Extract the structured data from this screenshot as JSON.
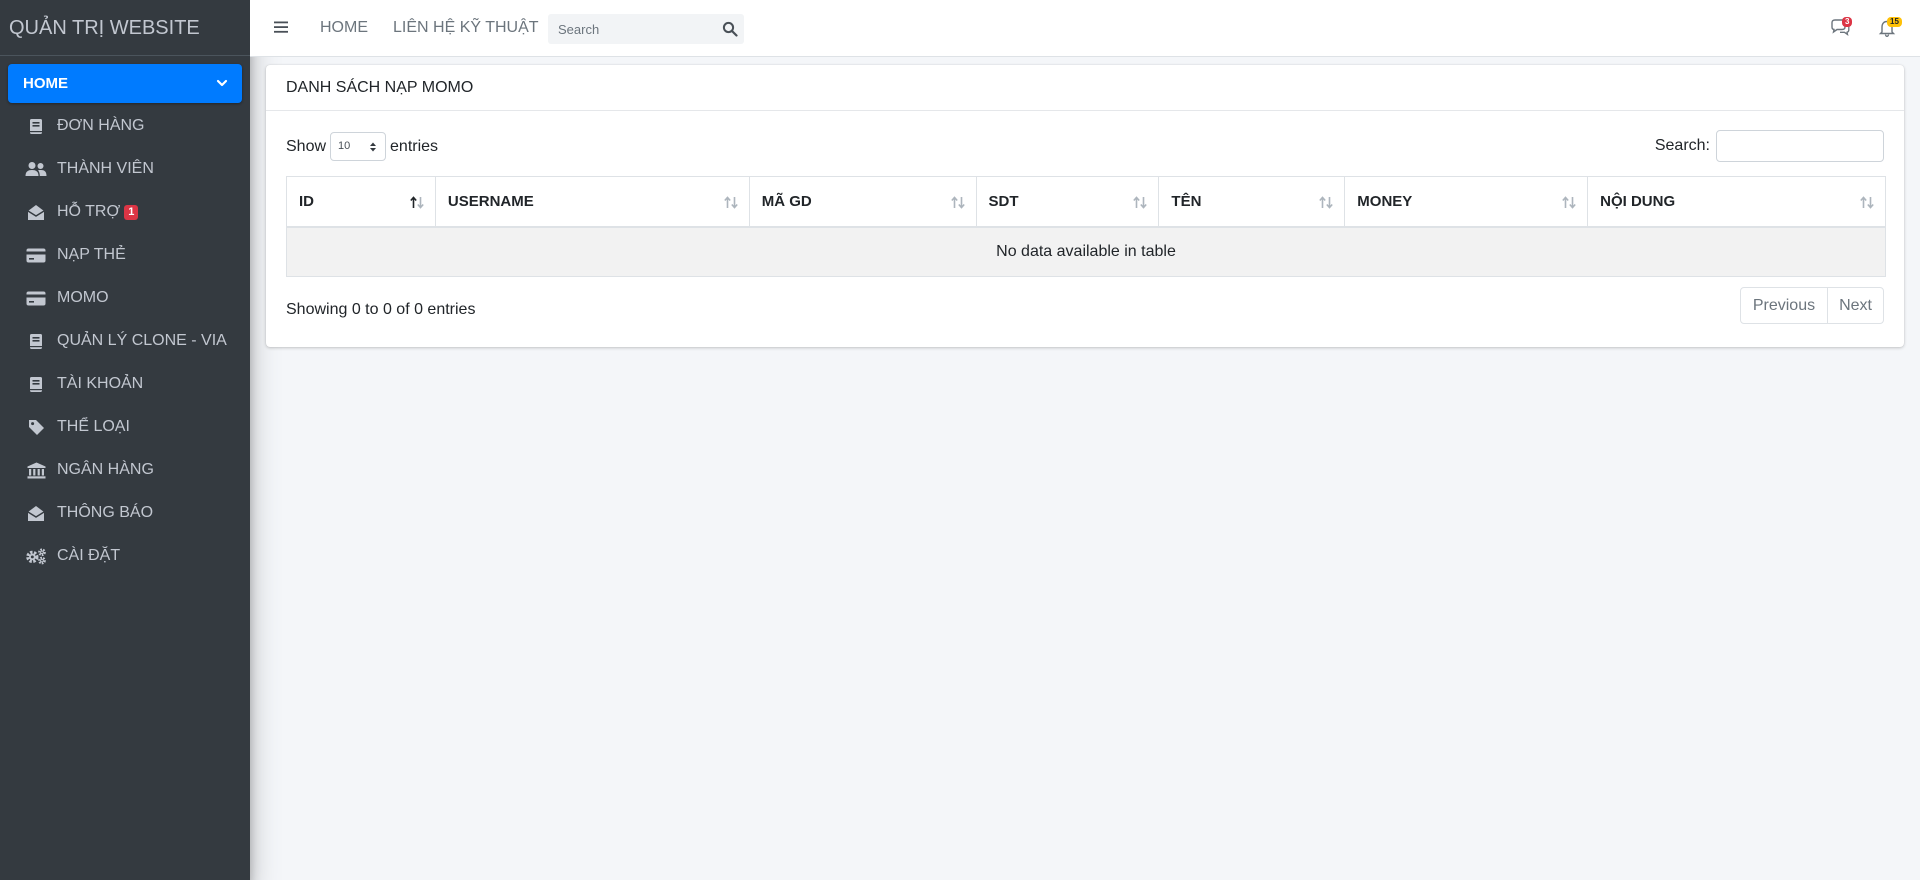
{
  "brand": "QUẢN TRỊ WEBSITE",
  "sidebar": {
    "active": "HOME",
    "items": [
      {
        "label": "ĐƠN HÀNG",
        "icon": "book-icon"
      },
      {
        "label": "THÀNH VIÊN",
        "icon": "users-icon"
      },
      {
        "label": "HỖ TRỢ",
        "icon": "envelope-open-icon",
        "badge": "1"
      },
      {
        "label": "NẠP THẺ",
        "icon": "credit-card-icon"
      },
      {
        "label": "MOMO",
        "icon": "credit-card-icon"
      },
      {
        "label": "QUẢN LÝ CLONE - VIA",
        "icon": "book-icon"
      },
      {
        "label": "TÀI KHOẢN",
        "icon": "book-icon"
      },
      {
        "label": "THỂ LOẠI",
        "icon": "tag-icon"
      },
      {
        "label": "NGÂN HÀNG",
        "icon": "bank-icon"
      },
      {
        "label": "THÔNG BÁO",
        "icon": "envelope-open-icon"
      },
      {
        "label": "CÀI ĐẶT",
        "icon": "cogs-icon"
      }
    ]
  },
  "topbar": {
    "links": [
      "HOME",
      "LIÊN HỆ KỸ THUẬT"
    ],
    "search_placeholder": "Search",
    "messages_badge": "3",
    "notifications_badge": "15"
  },
  "card": {
    "title": "DANH SÁCH NẠP MOMO",
    "show_label": "Show",
    "page_length": "10",
    "entries_label": "entries",
    "search_label": "Search:",
    "columns": [
      "ID",
      "USERNAME",
      "MÃ GD",
      "SDT",
      "TÊN",
      "MONEY",
      "NỘI DUNG"
    ],
    "empty_message": "No data available in table",
    "info": "Showing 0 to 0 of 0 entries",
    "previous": "Previous",
    "next": "Next"
  },
  "colors": {
    "sidebar_bg": "#343a40",
    "active_item": "#007bff",
    "badge_red": "#dc3545",
    "badge_yellow": "#ffc107",
    "content_bg": "#f4f6f9"
  }
}
